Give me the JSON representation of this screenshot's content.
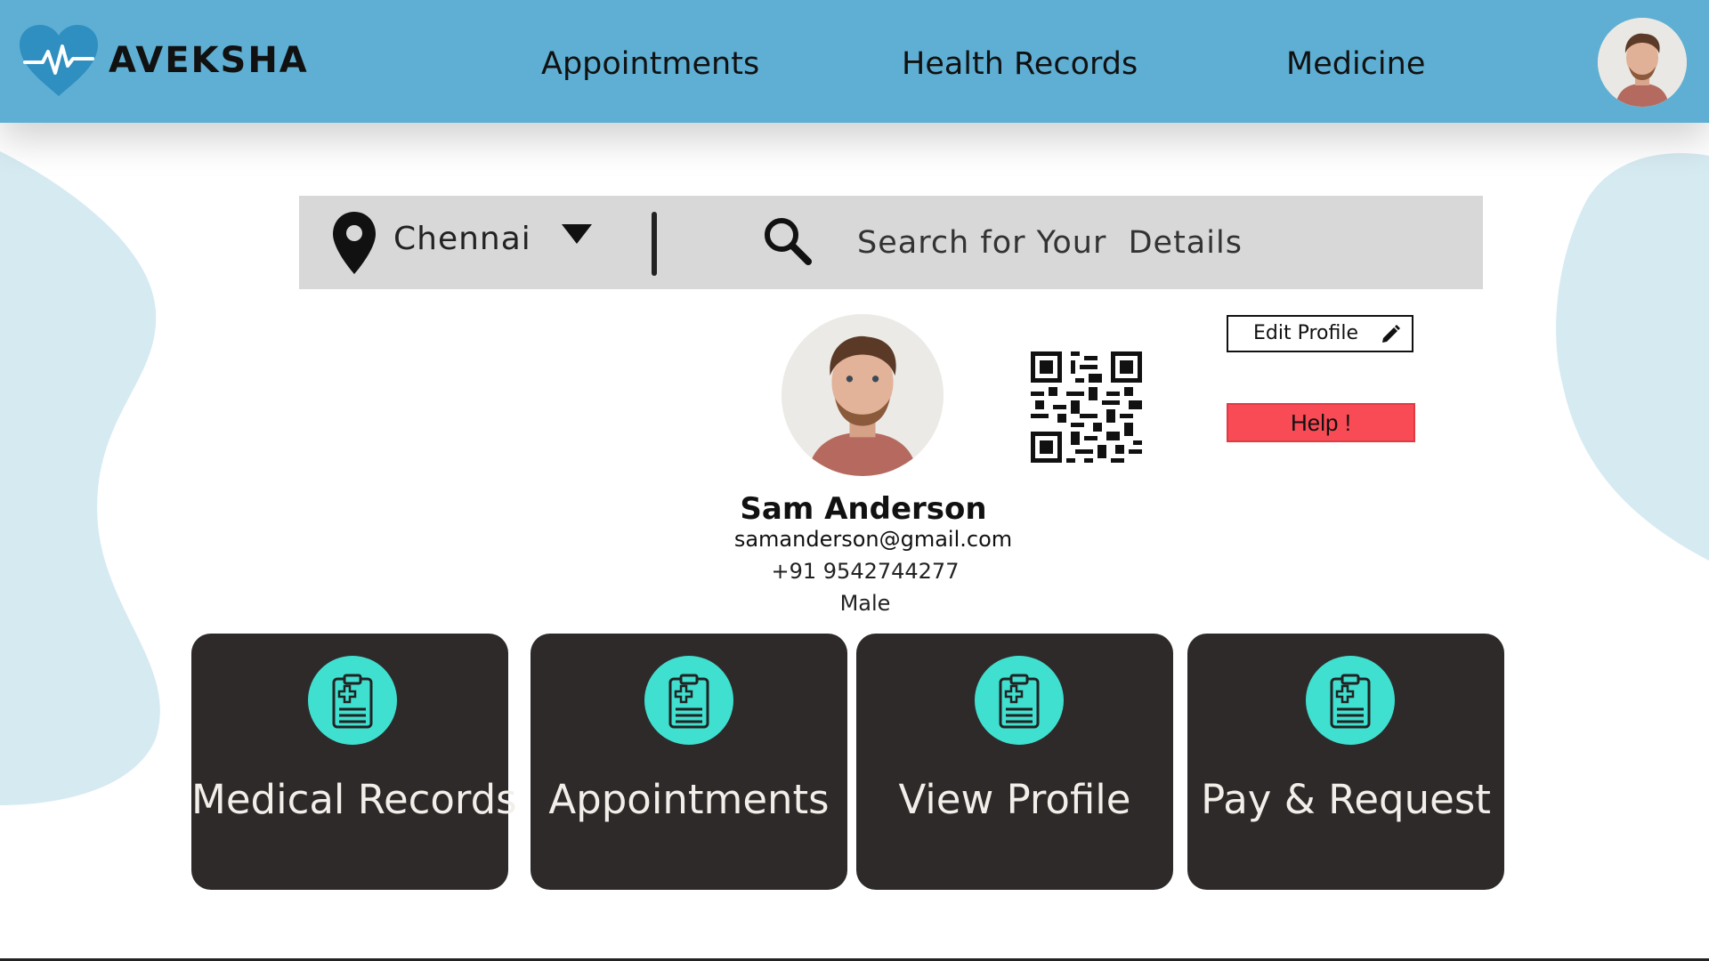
{
  "app": {
    "brand_name": "AVEKSHA",
    "accent_color": "#5eafd3",
    "card_color": "#2e2a2a",
    "icon_color": "#40e0d0",
    "help_color": "#f94b55"
  },
  "nav": {
    "items": [
      {
        "label": "Appointments"
      },
      {
        "label": "Health Records"
      },
      {
        "label": "Medicine"
      }
    ]
  },
  "header": {
    "avatar_icon": "user-avatar"
  },
  "search": {
    "location": "Chennai",
    "placeholder": "Search for Your  Details",
    "location_icon": "map-pin-icon",
    "dropdown_icon": "triangle-down-icon",
    "search_icon": "magnifier-icon"
  },
  "profile": {
    "name": "Sam Anderson",
    "email": "samanderson@gmail.com",
    "phone": "+91 9542744277",
    "gender": "Male",
    "edit_label": "Edit Profile",
    "help_label": "Help !"
  },
  "cards": [
    {
      "label": "Medical Records",
      "icon": "clipboard-icon"
    },
    {
      "label": "Appointments",
      "icon": "clipboard-icon"
    },
    {
      "label": "View Profile",
      "icon": "clipboard-icon"
    },
    {
      "label": "Pay & Request",
      "icon": "clipboard-icon"
    }
  ]
}
